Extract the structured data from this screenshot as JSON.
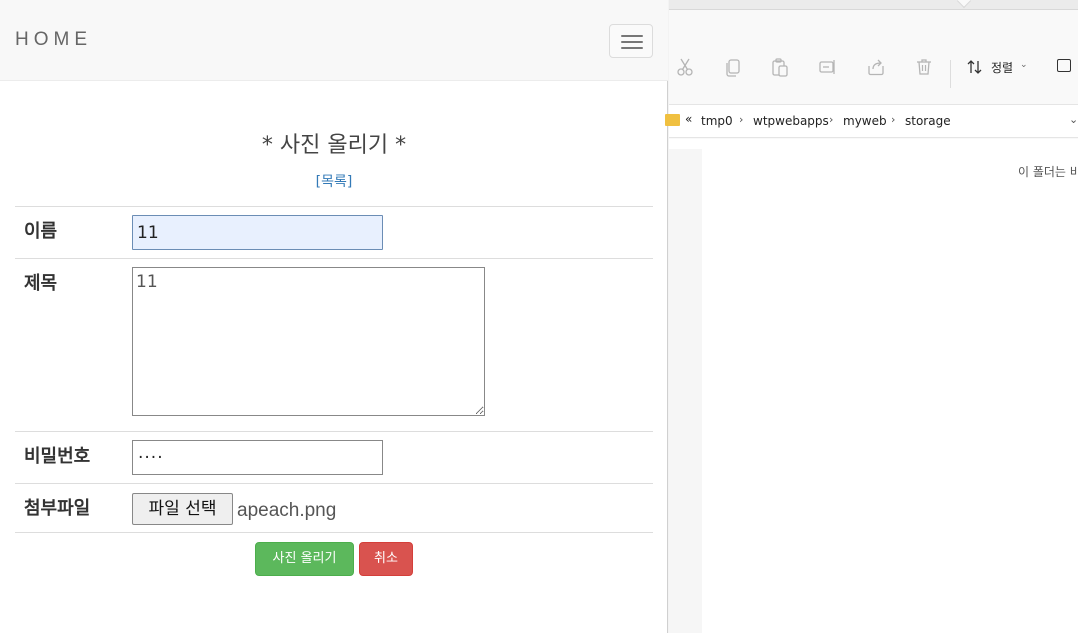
{
  "browser": {
    "brand": "HOME",
    "page_title": "* 사진 올리기 *",
    "list_link": "[목록]",
    "form": {
      "name_label": "이름",
      "name_value": "11",
      "title_label": "제목",
      "title_value": "11",
      "password_label": "비밀번호",
      "password_value": "····",
      "file_label": "첨부파일",
      "file_button": "파일 선택",
      "file_name": "apeach.png"
    },
    "buttons": {
      "submit": "사진 올리기",
      "cancel": "취소"
    }
  },
  "explorer": {
    "sort_label": "정렬",
    "breadcrumb_prefix": "«",
    "breadcrumb": [
      "tmp0",
      "wtpwebapps",
      "myweb",
      "storage"
    ],
    "empty_message": "이 폴더는 비"
  }
}
